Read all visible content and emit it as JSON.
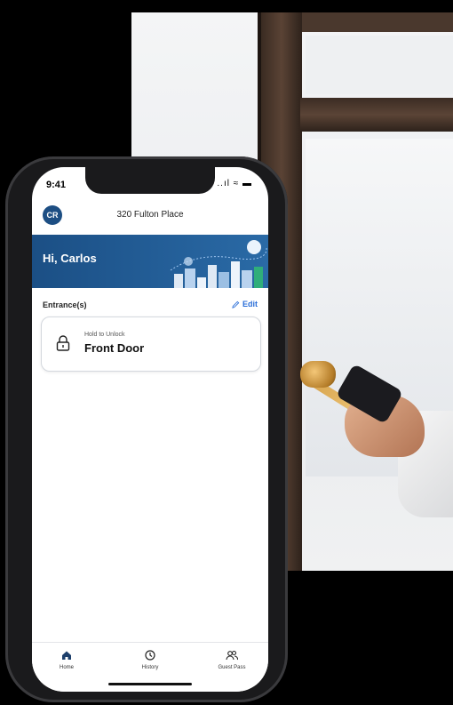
{
  "status_bar": {
    "time": "9:41",
    "indicators": "..ıl ≈ ▬"
  },
  "header": {
    "avatar_initials": "CR",
    "place_name": "320 Fulton Place"
  },
  "banner": {
    "greeting": "Hi, Carlos",
    "color": "#1b4f85"
  },
  "entrances": {
    "section_title": "Entrance(s)",
    "edit_label": "Edit",
    "items": [
      {
        "hint": "Hold to Unlock",
        "name": "Front Door",
        "icon": "lock-icon"
      }
    ]
  },
  "tabbar": {
    "items": [
      {
        "label": "Home",
        "icon": "home-icon"
      },
      {
        "label": "History",
        "icon": "clock-icon"
      },
      {
        "label": "Guest Pass",
        "icon": "users-icon"
      }
    ]
  },
  "accent_color": "#2a6ed8"
}
